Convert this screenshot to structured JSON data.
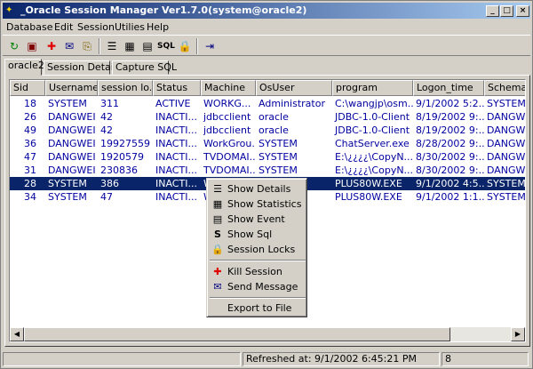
{
  "window": {
    "title": "_Oracle Session Manager Ver1.7.0(system@oracle2)",
    "minimize": "_",
    "maximize": "□",
    "close": "×"
  },
  "menu": [
    "Database",
    "Edit",
    "Session",
    "Utilies",
    "Help"
  ],
  "toolbar_icons": [
    "refresh-icon",
    "database-icon",
    "kill-session-icon",
    "send-message-icon",
    "export-icon",
    "details-icon",
    "statistics-icon",
    "event-icon",
    "sql-icon",
    "locks-icon",
    "exit-icon"
  ],
  "tabs": [
    "oracle2",
    "Session Details",
    "Capture SQL"
  ],
  "columns": [
    "Sid",
    "Username",
    "session lo...",
    "Status",
    "Machine",
    "OsUser",
    "program",
    "Logon_time",
    "Schema..."
  ],
  "rows": [
    [
      "18",
      "SYSTEM",
      "311",
      "ACTIVE",
      "WORKG...",
      "Administrator",
      "C:\\wangjp\\osm...",
      "9/1/2002 5:2...",
      "SYSTEM"
    ],
    [
      "26",
      "DANGWEI",
      "42",
      "INACTI...",
      "jdbcclient",
      "oracle",
      "JDBC-1.0-Client",
      "8/19/2002 9:...",
      "DANGWEI"
    ],
    [
      "49",
      "DANGWEI",
      "42",
      "INACTI...",
      "jdbcclient",
      "oracle",
      "JDBC-1.0-Client",
      "8/19/2002 9:...",
      "DANGWEI"
    ],
    [
      "36",
      "DANGWEI",
      "19927559",
      "INACTI...",
      "WorkGrou...",
      "SYSTEM",
      "ChatServer.exe",
      "8/28/2002 9:...",
      "DANGWEI"
    ],
    [
      "47",
      "DANGWEI",
      "1920579",
      "INACTI...",
      "TVDOMAI...",
      "SYSTEM",
      "E:\\¿¿¿¿\\CopyN...",
      "8/30/2002 9:...",
      "DANGWEI"
    ],
    [
      "31",
      "DANGWEI",
      "230836",
      "INACTI...",
      "TVDOMAI...",
      "SYSTEM",
      "E:\\¿¿¿¿\\CopyN...",
      "8/30/2002 9:...",
      "DANGWEI"
    ],
    [
      "28",
      "SYSTEM",
      "386",
      "INACTI...",
      "W...",
      "",
      "PLUS80W.EXE",
      "9/1/2002 4:5...",
      "SYSTEM"
    ],
    [
      "34",
      "SYSTEM",
      "47",
      "INACTI...",
      "W...",
      "",
      "PLUS80W.EXE",
      "9/1/2002 1:1...",
      "SYSTEM"
    ]
  ],
  "context_menu": [
    {
      "label": "Show Details",
      "icon": "details-icon",
      "glyph": "☰"
    },
    {
      "label": "Show Statistics",
      "icon": "statistics-icon",
      "glyph": "▦"
    },
    {
      "label": "Show Event",
      "icon": "event-icon",
      "glyph": "▤"
    },
    {
      "label": "Show Sql",
      "icon": "sql-icon",
      "glyph": "S"
    },
    {
      "label": "Session Locks",
      "icon": "lock-icon",
      "glyph": "🔒"
    },
    {
      "label": "Kill Session",
      "icon": "kill-icon",
      "glyph": "✚"
    },
    {
      "label": "Send Message",
      "icon": "message-icon",
      "glyph": "✉"
    },
    {
      "label": "Export to File",
      "icon": "",
      "glyph": ""
    }
  ],
  "status": {
    "refreshed": "Refreshed at: 9/1/2002 6:45:21 PM",
    "count": "8"
  }
}
